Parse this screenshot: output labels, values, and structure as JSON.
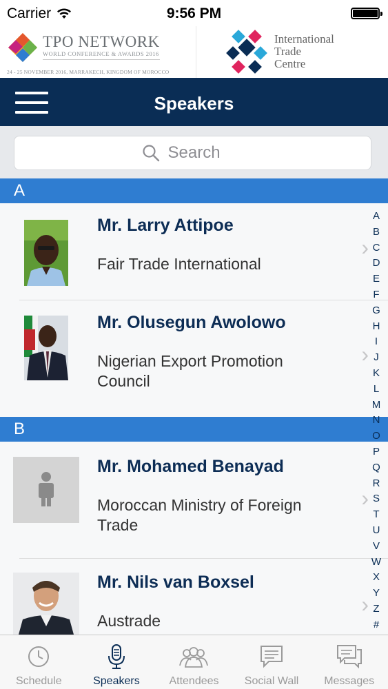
{
  "status_bar": {
    "carrier": "Carrier",
    "time": "9:56 PM"
  },
  "banner": {
    "tpo_title": "TPO NETWORK",
    "tpo_subtitle": "WORLD CONFERENCE & AWARDS 2016",
    "tpo_dates": "24 - 25 NOVEMBER 2016, MARRAKECH, KINGDOM OF MOROCCO",
    "itc_line1": "International",
    "itc_line2": "Trade",
    "itc_line3": "Centre"
  },
  "navbar": {
    "title": "Speakers",
    "menu_icon": "hamburger-icon"
  },
  "search": {
    "placeholder": "Search",
    "icon": "search-icon"
  },
  "sections": [
    {
      "letter": "A",
      "speakers": [
        {
          "name": "Mr. Larry Attipoe",
          "organization": "Fair Trade International"
        },
        {
          "name": "Mr. Olusegun Awolowo",
          "organization": "Nigerian Export Promotion Council"
        }
      ]
    },
    {
      "letter": "B",
      "speakers": [
        {
          "name": "Mr. Mohamed Benayad",
          "organization": "Moroccan Ministry of Foreign Trade"
        },
        {
          "name": "Mr. Nils van Boxsel",
          "organization": "Austrade"
        }
      ]
    }
  ],
  "index_letters": [
    "A",
    "B",
    "C",
    "D",
    "E",
    "F",
    "G",
    "H",
    "I",
    "J",
    "K",
    "L",
    "M",
    "N",
    "O",
    "P",
    "Q",
    "R",
    "S",
    "T",
    "U",
    "V",
    "W",
    "X",
    "Y",
    "Z",
    "#"
  ],
  "tabs": [
    {
      "label": "Schedule",
      "icon": "clock-icon",
      "active": false
    },
    {
      "label": "Speakers",
      "icon": "microphone-icon",
      "active": true
    },
    {
      "label": "Attendees",
      "icon": "people-icon",
      "active": false
    },
    {
      "label": "Social Wall",
      "icon": "chat-board-icon",
      "active": false
    },
    {
      "label": "Messages",
      "icon": "messages-icon",
      "active": false
    }
  ],
  "colors": {
    "navbar": "#0a2d55",
    "section_header": "#2f7dd1",
    "name_text": "#0d2d55",
    "active_tab": "#0a2d55",
    "inactive_tab": "#9a9a9a"
  }
}
